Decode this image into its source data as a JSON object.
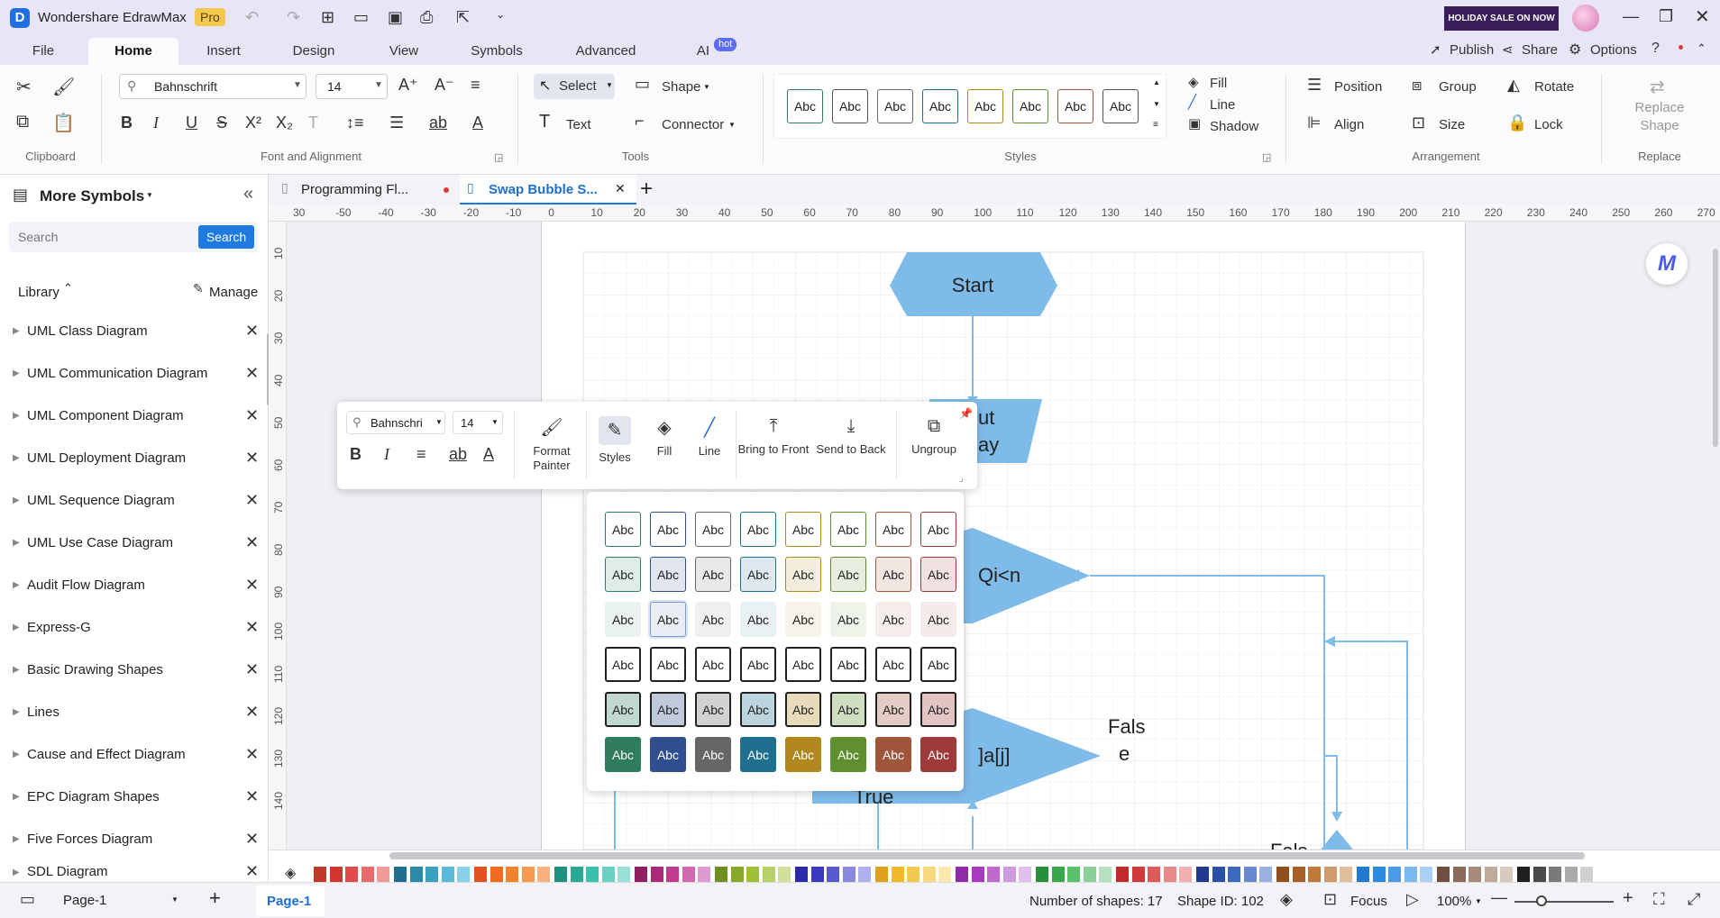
{
  "app": {
    "title": "Wondershare EdrawMax",
    "badge": "Pro",
    "promo": "HOLIDAY SALE ON NOW"
  },
  "menu": {
    "tabs": [
      "File",
      "Home",
      "Insert",
      "Design",
      "View",
      "Symbols",
      "Advanced",
      "AI"
    ],
    "ai_badge": "hot",
    "publish": "Publish",
    "share": "Share",
    "options": "Options"
  },
  "ribbon": {
    "font_name": "Bahnschrift",
    "font_size": "14",
    "select": "Select",
    "shape": "Shape",
    "text": "Text",
    "connector": "Connector",
    "style_label": "Abc",
    "fill": "Fill",
    "line": "Line",
    "shadow": "Shadow",
    "position": "Position",
    "group": "Group",
    "rotate": "Rotate",
    "align": "Align",
    "size": "Size",
    "lock": "Lock",
    "replace_shape": "Replace Shape",
    "groups": {
      "clipboard": "Clipboard",
      "font": "Font and Alignment",
      "tools": "Tools",
      "styles": "Styles",
      "arrangement": "Arrangement",
      "replace": "Replace"
    }
  },
  "sidebar": {
    "title": "More Symbols",
    "search_placeholder": "Search",
    "search_button": "Search",
    "library": "Library",
    "manage": "Manage",
    "items": [
      "UML Class Diagram",
      "UML Communication Diagram",
      "UML Component Diagram",
      "UML Deployment Diagram",
      "UML Sequence Diagram",
      "UML Use Case Diagram",
      "Audit Flow Diagram",
      "Express-G",
      "Basic Drawing Shapes",
      "Lines",
      "Cause and Effect Diagram",
      "EPC Diagram Shapes",
      "Five Forces Diagram",
      "SDL Diagram"
    ]
  },
  "doc_tabs": [
    {
      "label": "Programming Fl..."
    },
    {
      "label": "Swap Bubble S..."
    }
  ],
  "ruler": {
    "h": [
      "30",
      "-50",
      "-40",
      "-30",
      "-20",
      "-10",
      "0",
      "10",
      "20",
      "30",
      "40",
      "50",
      "60",
      "70",
      "80",
      "90",
      "100",
      "110",
      "120",
      "130",
      "140",
      "150",
      "160",
      "170",
      "180",
      "190",
      "200",
      "210",
      "220",
      "230",
      "240",
      "250",
      "260",
      "270"
    ],
    "v": [
      "10",
      "20",
      "30",
      "40",
      "50",
      "60",
      "70",
      "80",
      "90",
      "100",
      "110",
      "120",
      "130",
      "140"
    ]
  },
  "diagram": {
    "start": "Start",
    "input1": "ut",
    "input2": "ay",
    "cond1": "Qi<n",
    "cond2": "]a[j]",
    "false1": "Fals",
    "false2": "e",
    "true": "True",
    "false3": "Fals"
  },
  "floatbar": {
    "font_name": "Bahnschri",
    "font_size": "14",
    "format_painter": "Format Painter",
    "styles": "Styles",
    "fill": "Fill",
    "line": "Line",
    "bring_front": "Bring to Front",
    "send_back": "Send to Back",
    "ungroup": "Ungroup"
  },
  "style_popup": {
    "label": "Abc",
    "accent_colors": [
      "#2f7d5c",
      "#2f4f8f",
      "#666666",
      "#1f6f8f",
      "#b0881f",
      "#5f8f2f",
      "#a0563a",
      "#a03a3a"
    ]
  },
  "statusbar": {
    "page_select": "Page-1",
    "page_tab": "Page-1",
    "shape_count": "Number of shapes: 17",
    "shape_id": "Shape ID: 102",
    "focus": "Focus",
    "zoom": "100%"
  },
  "palette": [
    "#c0392b",
    "#d2342f",
    "#e04a4a",
    "#e86a6a",
    "#f09a9a",
    "#1f6f8f",
    "#2a8aa8",
    "#3aa0c0",
    "#5ab8d8",
    "#8ad0e8",
    "#e2521f",
    "#f06a1f",
    "#f3822f",
    "#f59a4f",
    "#f7b27f",
    "#1f8f7f",
    "#2aa896",
    "#3ac0ad",
    "#6ad0c4",
    "#9ae0d8",
    "#8f1f5f",
    "#a82a78",
    "#c03a8f",
    "#d06ab0",
    "#e09ad0",
    "#6f8f1f",
    "#88a82a",
    "#a0c03a",
    "#b8d06a",
    "#d0e09a",
    "#2a2aa8",
    "#3a3ac0",
    "#5a5ad0",
    "#8a8ae0",
    "#b0b0ef",
    "#e0a01f",
    "#f0b82a",
    "#f3c84f",
    "#f7d87f",
    "#fae8af",
    "#8f2aa8",
    "#a83ac0",
    "#c06ad0",
    "#d09ae0",
    "#e0c0ef",
    "#2a8f3a",
    "#3aa84a",
    "#5ac06a",
    "#8ad09a",
    "#b8e0c0",
    "#c02a2a",
    "#d03a3a",
    "#e05a5a",
    "#e88a8a",
    "#f0b0b0",
    "#1f3a8f",
    "#2a4fa8",
    "#3a6ac0",
    "#6a8ad0",
    "#9ab0e0",
    "#8f4f1f",
    "#a8602a",
    "#c07a3a",
    "#d09a6a",
    "#e0bf9a",
    "#1f7ad0",
    "#2a8ae0",
    "#4a9ae8",
    "#7ab8f0",
    "#aad0f7",
    "#6f4f3f",
    "#8a6a5a",
    "#a88a7a",
    "#c0aa9a",
    "#d8cabf",
    "#1f1f1f",
    "#4a4a4a",
    "#7a7a7a",
    "#aaaaaa",
    "#d0d0d0"
  ]
}
